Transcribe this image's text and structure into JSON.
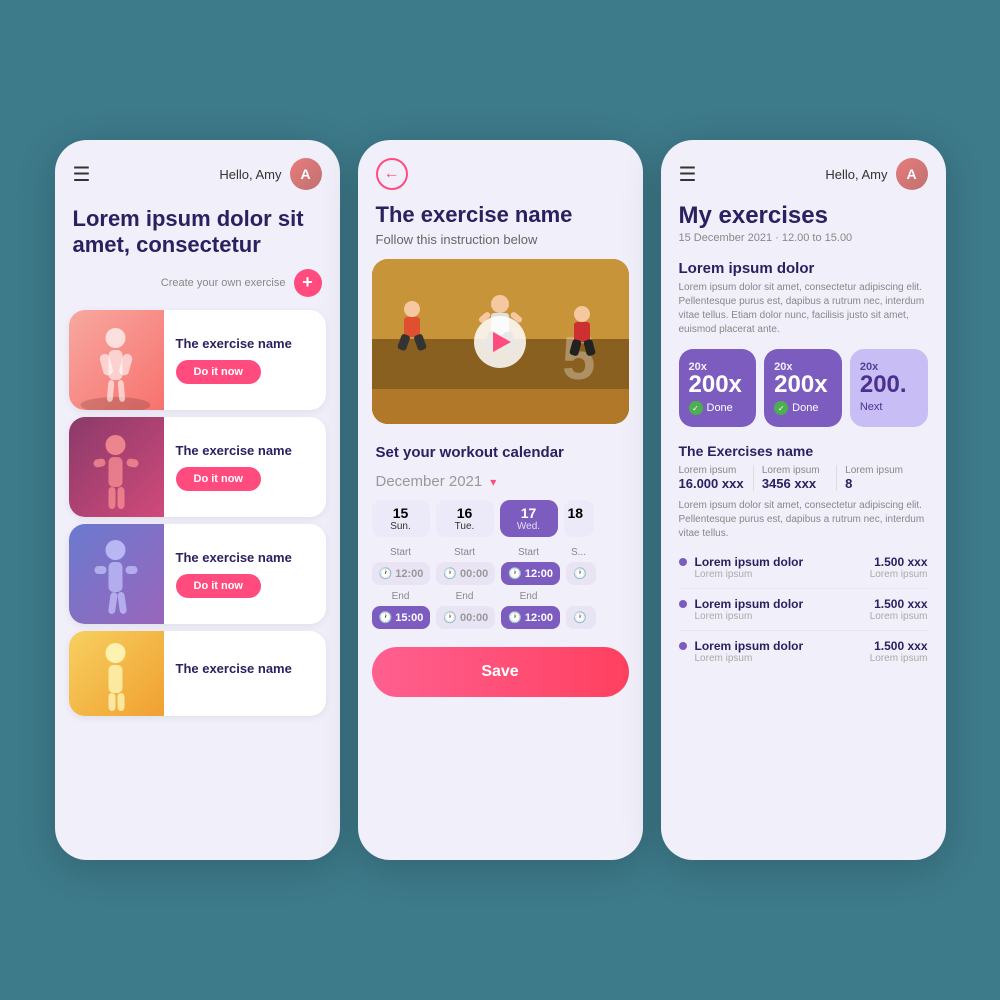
{
  "phone1": {
    "hello": "Hello, Amy",
    "menu_icon": "☰",
    "title": "Lorem ipsum dolor sit amet, consectetur",
    "create_label": "Create your own exercise",
    "plus": "+",
    "cards": [
      {
        "exercise_title": "The exercise name",
        "btn": "Do it now",
        "color": "card-img-1",
        "emoji": "🏋️"
      },
      {
        "exercise_title": "The exercise name",
        "btn": "Do it now",
        "color": "card-img-2",
        "emoji": "💪"
      },
      {
        "exercise_title": "The exercise name",
        "btn": "Do it now",
        "color": "card-img-3",
        "emoji": "🏋️"
      },
      {
        "exercise_title": "The exercise name",
        "btn": "",
        "color": "card-img-4",
        "emoji": "🏃"
      }
    ]
  },
  "phone2": {
    "back": "←",
    "title": "The exercise name",
    "subtitle": "Follow this instruction below",
    "workout_label": "Set your workout calendar",
    "month": "December 2021",
    "days": [
      {
        "num": "15",
        "name": "Sun.",
        "active": false
      },
      {
        "num": "16",
        "name": "Tue.",
        "active": false
      },
      {
        "num": "17",
        "name": "Wed.",
        "active": true
      },
      {
        "num": "18",
        "name": "",
        "partial": true
      }
    ],
    "start_label": "Start",
    "end_label": "End",
    "time_rows": [
      {
        "times": [
          "12:00",
          "00:00",
          "12:00",
          ""
        ],
        "types": [
          "purple",
          "gray",
          "purple",
          "partial"
        ]
      },
      {
        "times": [
          "15:00",
          "00:00",
          "12:00",
          ""
        ],
        "types": [
          "purple",
          "gray",
          "purple",
          "partial"
        ]
      }
    ],
    "save_btn": "Save"
  },
  "phone3": {
    "hello": "Hello, Amy",
    "title": "My exercises",
    "date": "15 December 2021 · 12.00 to 15.00",
    "section1_title": "Lorem ipsum dolor",
    "section1_desc": "Lorem ipsum dolor sit amet, consectetur adipiscing elit. Pellentesque purus est, dapibus a rutrum nec, interdum vitae tellus. Etiam dolor nunc, facilisis justo sit amet, euismod placerat ante.",
    "metrics": [
      {
        "top": "20x",
        "val": "200x",
        "done": "Done",
        "light": false
      },
      {
        "top": "20x",
        "val": "200x",
        "done": "Done",
        "light": false
      },
      {
        "top": "20x",
        "val": "200.",
        "done": "Next",
        "light": true
      }
    ],
    "ex_title": "The Exercises name",
    "stats": [
      {
        "label": "Lorem ipsum",
        "val": "16.000 xxx"
      },
      {
        "label": "Lorem ipsum",
        "val": "3456 xxx"
      },
      {
        "label": "Lorem ipsum",
        "val": "8"
      }
    ],
    "body_text": "Lorem ipsum dolor sit amet, consectetur adipiscing elit. Pellentesque purus est, dapibus a rutrum nec, interdum vitae tellus.",
    "list_items": [
      {
        "name": "Lorem ipsum dolor",
        "sub": "Lorem ipsum",
        "val": "1.500 xxx",
        "sub2": "Lorem ipsum"
      },
      {
        "name": "Lorem ipsum dolor",
        "sub": "Lorem ipsum",
        "val": "1.500 xxx",
        "sub2": "Lorem ipsum"
      },
      {
        "name": "Lorem ipsum dolor",
        "sub": "Lorem ipsum",
        "val": "1.500 xxx",
        "sub2": "Lorem ipsum"
      }
    ]
  }
}
